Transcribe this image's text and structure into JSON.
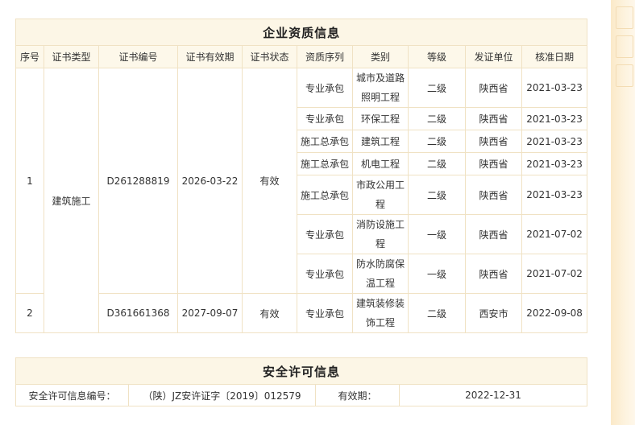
{
  "qualification": {
    "title": "企业资质信息",
    "headers": [
      "序号",
      "证书类型",
      "证书编号",
      "证书有效期",
      "证书状态",
      "资质序列",
      "类别",
      "等级",
      "发证单位",
      "核准日期"
    ],
    "certificate_type": "建筑施工",
    "certificates": [
      {
        "no": "1",
        "cert_number": "D261288819",
        "valid_until": "2026-03-22",
        "status": "有效",
        "rows": [
          {
            "series": "专业承包",
            "category_l1": "城市及道路",
            "category_l2": "照明工程",
            "grade": "二级",
            "issuer": "陕西省",
            "date": "2021-03-23"
          },
          {
            "series": "专业承包",
            "category_l1": "环保工程",
            "category_l2": "",
            "grade": "二级",
            "issuer": "陕西省",
            "date": "2021-03-23"
          },
          {
            "series": "施工总承包",
            "category_l1": "建筑工程",
            "category_l2": "",
            "grade": "二级",
            "issuer": "陕西省",
            "date": "2021-03-23"
          },
          {
            "series": "施工总承包",
            "category_l1": "机电工程",
            "category_l2": "",
            "grade": "二级",
            "issuer": "陕西省",
            "date": "2021-03-23"
          },
          {
            "series": "施工总承包",
            "category_l1": "市政公用工",
            "category_l2": "程",
            "grade": "二级",
            "issuer": "陕西省",
            "date": "2021-03-23"
          },
          {
            "series": "专业承包",
            "category_l1": "消防设施工",
            "category_l2": "程",
            "grade": "一级",
            "issuer": "陕西省",
            "date": "2021-07-02"
          },
          {
            "series": "专业承包",
            "category_l1": "防水防腐保",
            "category_l2": "温工程",
            "grade": "一级",
            "issuer": "陕西省",
            "date": "2021-07-02"
          }
        ]
      },
      {
        "no": "2",
        "cert_number": "D361661368",
        "valid_until": "2027-09-07",
        "status": "有效",
        "rows": [
          {
            "series": "专业承包",
            "category_l1": "建筑装修装",
            "category_l2": "饰工程",
            "grade": "二级",
            "issuer": "西安市",
            "date": "2022-09-08"
          }
        ]
      }
    ]
  },
  "safety": {
    "title": "安全许可信息",
    "number_label": "安全许可信息编号：",
    "number_value": "（陕）JZ安许证字〔2019〕012579",
    "validity_label": "有效期：",
    "validity_value": "2022-12-31"
  }
}
